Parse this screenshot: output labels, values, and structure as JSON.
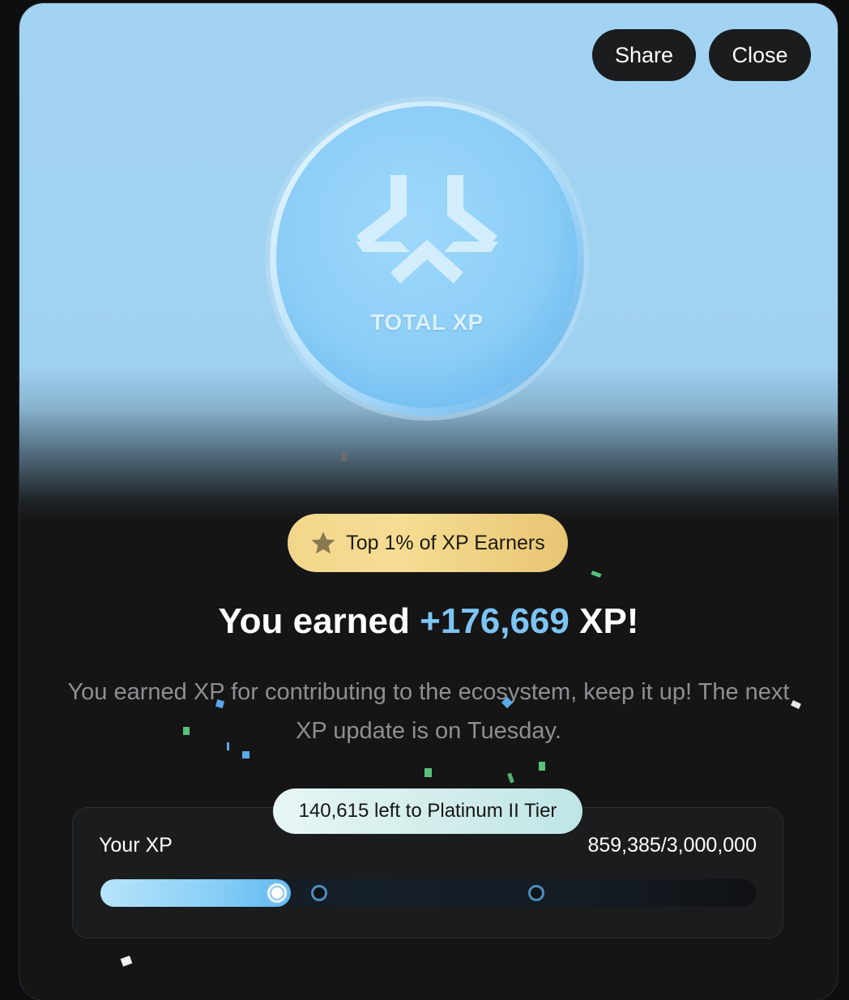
{
  "header": {
    "share_label": "Share",
    "close_label": "Close"
  },
  "coin": {
    "label": "TOTAL XP",
    "icon": "xp-logo-icon"
  },
  "badge": {
    "icon": "star-icon",
    "text": "Top 1% of XP Earners"
  },
  "headline": {
    "prefix": "You earned ",
    "amount": "+176,669",
    "suffix": " XP!"
  },
  "description": "You earned XP for contributing to the ecosystem, keep it up! The next XP update is on Tuesday.",
  "tier": {
    "remaining_text": "140,615 left to Platinum II Tier"
  },
  "xp": {
    "label": "Your XP",
    "value_text": "859,385/3,000,000",
    "current": 859385,
    "max": 3000000,
    "progress_fraction": 0.29
  },
  "colors": {
    "accent": "#7cc4f4",
    "badge_gold": "#f2d68c",
    "hero_blue": "#a2d3f2"
  }
}
